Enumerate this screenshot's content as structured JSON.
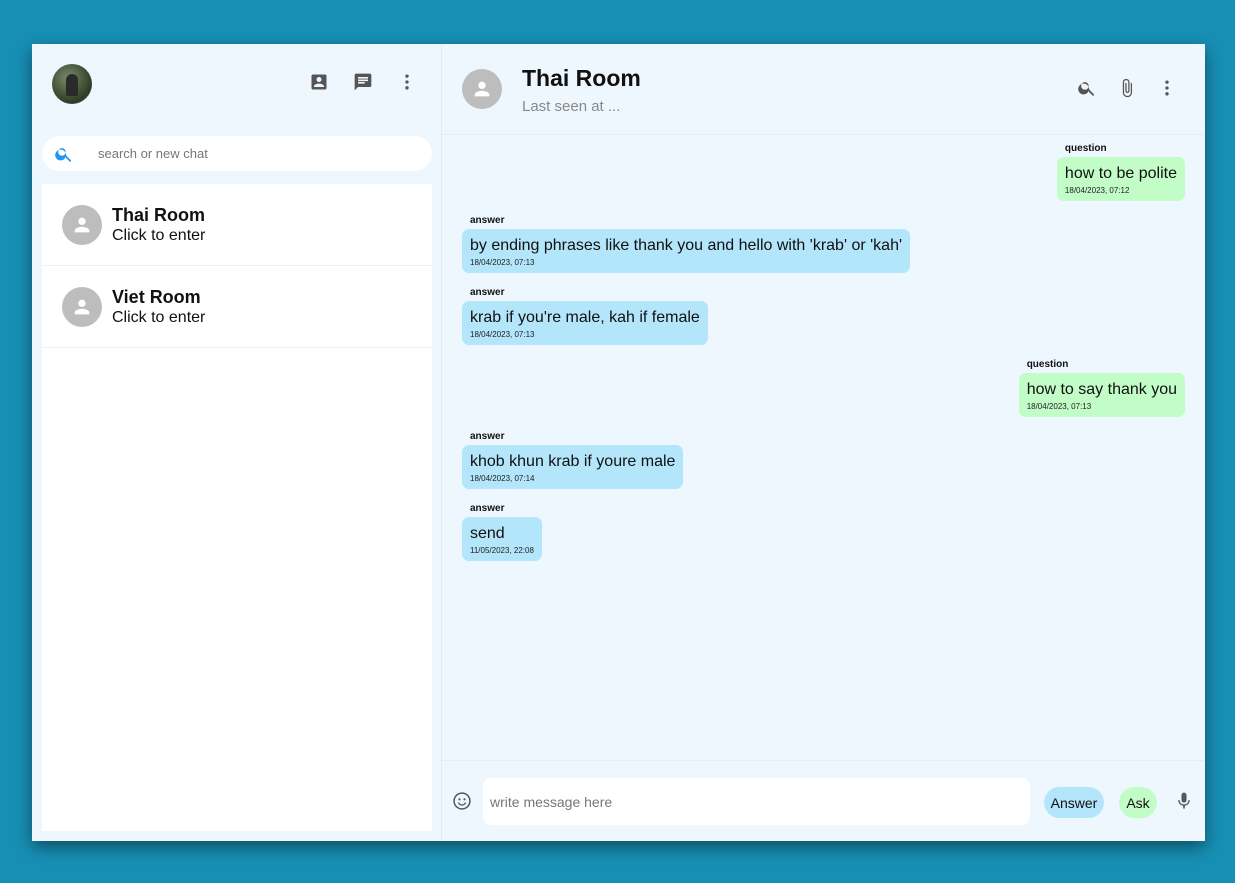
{
  "sidebar": {
    "search_placeholder": "search or new chat",
    "icons": [
      "contacts-icon",
      "chat-icon",
      "more-vert-icon"
    ],
    "chats": [
      {
        "name": "Thai Room",
        "subtitle": "Click to enter"
      },
      {
        "name": "Viet Room",
        "subtitle": "Click to enter"
      }
    ]
  },
  "main": {
    "title": "Thai Room",
    "last_seen": "Last seen at ...",
    "messages": [
      {
        "role": "question",
        "text": "how to be polite",
        "time": "18/04/2023, 07:12"
      },
      {
        "role": "answer",
        "text": "by ending phrases like thank you and hello with 'krab' or 'kah'",
        "time": "18/04/2023, 07:13"
      },
      {
        "role": "answer",
        "text": "krab if you're male, kah if female",
        "time": "18/04/2023, 07:13"
      },
      {
        "role": "question",
        "text": "how to say thank you",
        "time": "18/04/2023, 07:13"
      },
      {
        "role": "answer",
        "text": "khob khun krab if youre male",
        "time": "18/04/2023, 07:14"
      },
      {
        "role": "answer",
        "text": "send",
        "time": "11/05/2023, 22:08"
      }
    ]
  },
  "composer": {
    "placeholder": "write message here",
    "answer_label": "Answer",
    "ask_label": "Ask"
  },
  "colors": {
    "background": "#178fb5",
    "question_bubble": "#c2fcc6",
    "answer_bubble": "#b3e5fb",
    "search_accent": "#2196f3"
  }
}
